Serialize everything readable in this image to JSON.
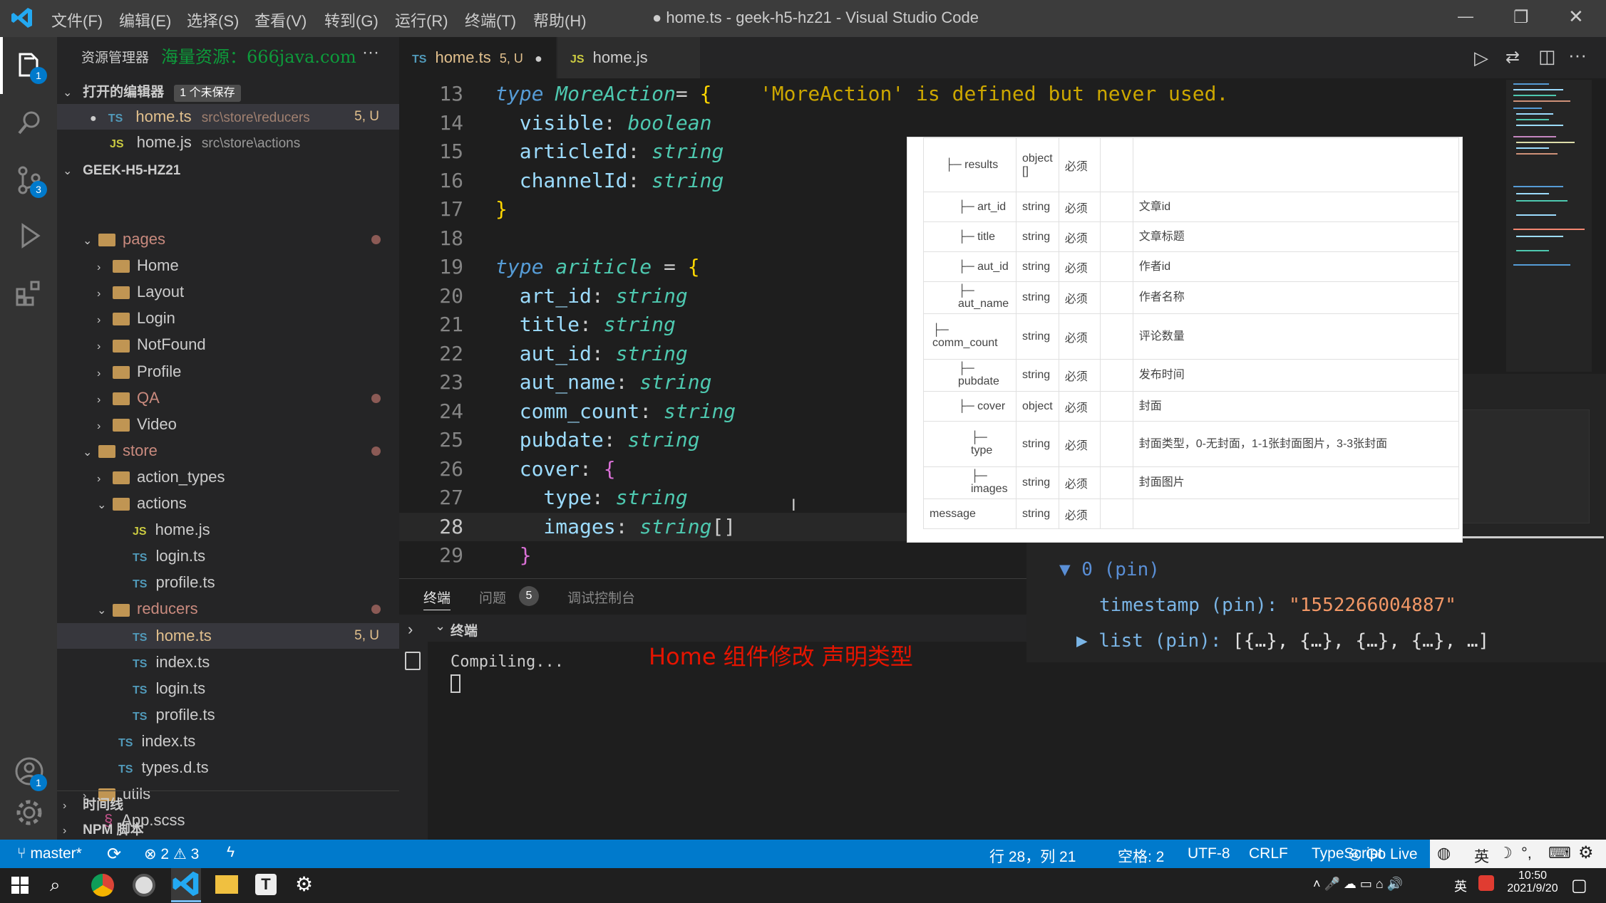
{
  "titlebar": {
    "menus": [
      "文件(F)",
      "编辑(E)",
      "选择(S)",
      "查看(V)",
      "转到(G)",
      "运行(R)",
      "终端(T)",
      "帮助(H)"
    ],
    "title": "● home.ts - geek-h5-hz21 - Visual Studio Code",
    "minimize": "—",
    "restore": "❐",
    "close": "✕"
  },
  "activity": {
    "explorer_badge": "1",
    "scm_badge": "3",
    "account_badge": "1"
  },
  "sidebar": {
    "header": "资源管理器",
    "watermark": "海量资源：666java.com",
    "more": "···",
    "open_editors": {
      "label": "打开的编辑器",
      "unsaved": "1 个未保存",
      "items": [
        {
          "icon": "TS",
          "name": "home.ts",
          "path": "src\\store\\reducers",
          "status": "5, U"
        },
        {
          "icon": "JS",
          "name": "home.js",
          "path": "src\\store\\actions",
          "status": ""
        }
      ]
    },
    "project": "GEEK-H5-HZ21",
    "tree": [
      {
        "name": "pages",
        "kind": "folder-open",
        "indent": 0,
        "modified": true
      },
      {
        "name": "Home",
        "kind": "folder",
        "indent": 1
      },
      {
        "name": "Layout",
        "kind": "folder",
        "indent": 1
      },
      {
        "name": "Login",
        "kind": "folder",
        "indent": 1
      },
      {
        "name": "NotFound",
        "kind": "folder",
        "indent": 1
      },
      {
        "name": "Profile",
        "kind": "folder",
        "indent": 1
      },
      {
        "name": "QA",
        "kind": "folder",
        "indent": 1,
        "modified": true
      },
      {
        "name": "Video",
        "kind": "folder",
        "indent": 1
      },
      {
        "name": "store",
        "kind": "folder-open",
        "indent": 0,
        "modified": true
      },
      {
        "name": "action_types",
        "kind": "folder",
        "indent": 1
      },
      {
        "name": "actions",
        "kind": "folder-open",
        "indent": 1
      },
      {
        "name": "home.js",
        "kind": "js",
        "indent": 2
      },
      {
        "name": "login.ts",
        "kind": "ts",
        "indent": 2
      },
      {
        "name": "profile.ts",
        "kind": "ts",
        "indent": 2
      },
      {
        "name": "reducers",
        "kind": "folder-open",
        "indent": 1,
        "modified": true
      },
      {
        "name": "home.ts",
        "kind": "ts",
        "indent": 2,
        "status": "5, U",
        "selected": true
      },
      {
        "name": "index.ts",
        "kind": "ts",
        "indent": 2
      },
      {
        "name": "login.ts",
        "kind": "ts",
        "indent": 2
      },
      {
        "name": "profile.ts",
        "kind": "ts",
        "indent": 2
      },
      {
        "name": "index.ts",
        "kind": "ts",
        "indent": 1
      },
      {
        "name": "types.d.ts",
        "kind": "ts",
        "indent": 1
      },
      {
        "name": "utils",
        "kind": "folder",
        "indent": 0
      },
      {
        "name": "App.scss",
        "kind": "scss",
        "indent": 0
      }
    ],
    "timeline": "时间线",
    "npm": "NPM 脚本"
  },
  "tabs": [
    {
      "icon": "TS",
      "name": "home.ts",
      "status": "5, U",
      "active": true,
      "dirty": "●"
    },
    {
      "icon": "JS",
      "name": "home.js",
      "status": "",
      "active": false
    }
  ],
  "code": {
    "lines": [
      {
        "n": "13",
        "tokens": [
          [
            "kw",
            "type "
          ],
          [
            "tp",
            "MoreAction"
          ],
          [
            "",
            "="
          ],
          [
            "br",
            " {"
          ]
        ],
        "warn": "    'MoreAction' is defined but never used."
      },
      {
        "n": "14",
        "tokens": [
          [
            "prop",
            "  visible"
          ],
          [
            "",
            ": "
          ],
          [
            "tp",
            "boolean"
          ]
        ]
      },
      {
        "n": "15",
        "tokens": [
          [
            "prop",
            "  articleId"
          ],
          [
            "",
            ": "
          ],
          [
            "tp",
            "string"
          ]
        ]
      },
      {
        "n": "16",
        "tokens": [
          [
            "prop",
            "  channelId"
          ],
          [
            "",
            ": "
          ],
          [
            "tp",
            "string"
          ]
        ]
      },
      {
        "n": "17",
        "tokens": [
          [
            "br",
            "}"
          ]
        ]
      },
      {
        "n": "18",
        "tokens": []
      },
      {
        "n": "19",
        "tokens": [
          [
            "kw",
            "type "
          ],
          [
            "tp",
            "ariticle"
          ],
          [
            "",
            " = "
          ],
          [
            "br",
            "{"
          ]
        ]
      },
      {
        "n": "20",
        "tokens": [
          [
            "prop",
            "  art_id"
          ],
          [
            "",
            ": "
          ],
          [
            "tp",
            "string"
          ]
        ]
      },
      {
        "n": "21",
        "tokens": [
          [
            "prop",
            "  title"
          ],
          [
            "",
            ": "
          ],
          [
            "tp",
            "string"
          ]
        ]
      },
      {
        "n": "22",
        "tokens": [
          [
            "prop",
            "  aut_id"
          ],
          [
            "",
            ": "
          ],
          [
            "tp",
            "string"
          ]
        ]
      },
      {
        "n": "23",
        "tokens": [
          [
            "prop",
            "  aut_name"
          ],
          [
            "",
            ": "
          ],
          [
            "tp",
            "string"
          ]
        ]
      },
      {
        "n": "24",
        "tokens": [
          [
            "prop",
            "  comm_count"
          ],
          [
            "",
            ": "
          ],
          [
            "tp",
            "string"
          ]
        ]
      },
      {
        "n": "25",
        "tokens": [
          [
            "prop",
            "  pubdate"
          ],
          [
            "",
            ": "
          ],
          [
            "tp",
            "string"
          ]
        ]
      },
      {
        "n": "26",
        "tokens": [
          [
            "prop",
            "  cover"
          ],
          [
            "",
            ": "
          ],
          [
            "br2",
            "{"
          ]
        ]
      },
      {
        "n": "27",
        "tokens": [
          [
            "prop",
            "    type"
          ],
          [
            "",
            ": "
          ],
          [
            "tp",
            "string"
          ]
        ]
      },
      {
        "n": "28",
        "tokens": [
          [
            "prop",
            "    images"
          ],
          [
            "",
            ": "
          ],
          [
            "tp",
            "string"
          ],
          [
            "",
            "[]"
          ]
        ],
        "current": true
      },
      {
        "n": "29",
        "tokens": [
          [
            "br2",
            "  }"
          ]
        ]
      }
    ]
  },
  "api_table": {
    "rows": [
      {
        "name": "├─ results",
        "type": "object []",
        "req": "必须",
        "desc": ""
      },
      {
        "name": "├─ art_id",
        "type": "string",
        "req": "必须",
        "desc": "文章id"
      },
      {
        "name": "├─ title",
        "type": "string",
        "req": "必须",
        "desc": "文章标题"
      },
      {
        "name": "├─ aut_id",
        "type": "string",
        "req": "必须",
        "desc": "作者id"
      },
      {
        "name": "├─ aut_name",
        "type": "string",
        "req": "必须",
        "desc": "作者名称"
      },
      {
        "name": "├─ comm_count",
        "type": "string",
        "req": "必须",
        "desc": "评论数量"
      },
      {
        "name": "├─ pubdate",
        "type": "string",
        "req": "必须",
        "desc": "发布时间"
      },
      {
        "name": "├─ cover",
        "type": "object",
        "req": "必须",
        "desc": "封面"
      },
      {
        "name": "├─ type",
        "type": "string",
        "req": "必须",
        "desc": "封面类型，0-无封面，1-1张封面图片，3-3张封面"
      },
      {
        "name": "├─ images",
        "type": "string",
        "req": "必须",
        "desc": "封面图片"
      },
      {
        "name": "message",
        "type": "string",
        "req": "必须",
        "desc": ""
      }
    ]
  },
  "devtools": {
    "node": "▼ 0 (pin)",
    "timestamp_key": "timestamp (pin): ",
    "timestamp_val": "\"1552266004887\"",
    "list_key": "▶ list (pin): ",
    "list_val": "[{…}, {…}, {…}, {…}, …]"
  },
  "panel": {
    "tabs": [
      "终端",
      "问题",
      "调试控制台"
    ],
    "problems_count": "5",
    "terminal_label": "终端",
    "output": "Compiling...",
    "annotation": "Home   组件修改   声明类型"
  },
  "statusbar": {
    "branch": "master*",
    "errors": "⊗ 2",
    "warnings": "⚠ 3",
    "cursor": "行 28，列 21",
    "spaces": "空格: 2",
    "encoding": "UTF-8",
    "eol": "CRLF",
    "language": "TypeScript",
    "golive": "Go Live",
    "ime": "英"
  },
  "taskbar": {
    "time": "10:50",
    "date": "2021/9/20",
    "ime": "英"
  }
}
